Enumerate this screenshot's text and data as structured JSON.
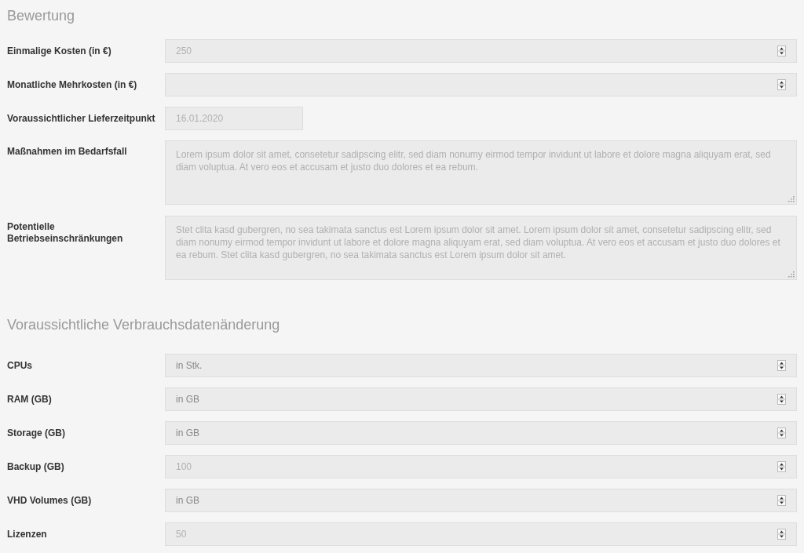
{
  "sections": [
    {
      "title": "Bewertung",
      "fields": [
        {
          "kind": "number",
          "label": "Einmalige Kosten (in €)",
          "value": "250"
        },
        {
          "kind": "number",
          "label": "Monatliche Mehrkosten (in €)"
        },
        {
          "kind": "date",
          "label": "Voraussichtlicher Lieferzeitpunkt",
          "value": "16.01.2020"
        },
        {
          "kind": "textarea",
          "label": "Maßnahmen im Bedarfsfall",
          "value": "Lorem ipsum dolor sit amet, consetetur sadipscing elitr, sed diam nonumy eirmod tempor invidunt ut labore et dolore magna aliquyam erat, sed diam voluptua. At vero eos et accusam et justo duo dolores et ea rebum."
        },
        {
          "kind": "textarea",
          "label": "Potentielle Betriebseinschränkungen",
          "value": "Stet clita kasd gubergren, no sea takimata sanctus est Lorem ipsum dolor sit amet. Lorem ipsum dolor sit amet, consetetur sadipscing elitr, sed diam nonumy eirmod tempor invidunt ut labore et dolore magna aliquyam erat, sed diam voluptua. At vero eos et accusam et justo duo dolores et ea rebum. Stet clita kasd gubergren, no sea takimata sanctus est Lorem ipsum dolor sit amet."
        }
      ]
    },
    {
      "title": "Voraussichtliche Verbrauchsdatenänderung",
      "fields": [
        {
          "kind": "number",
          "label": "CPUs",
          "placeholder": "in Stk."
        },
        {
          "kind": "number",
          "label": "RAM (GB)",
          "placeholder": "in GB"
        },
        {
          "kind": "number",
          "label": "Storage (GB)",
          "placeholder": "in GB"
        },
        {
          "kind": "number",
          "label": "Backup (GB)",
          "value": "100"
        },
        {
          "kind": "number",
          "label": "VHD Volumes (GB)",
          "placeholder": "in GB"
        },
        {
          "kind": "number",
          "label": "Lizenzen",
          "value": "50"
        }
      ]
    }
  ]
}
